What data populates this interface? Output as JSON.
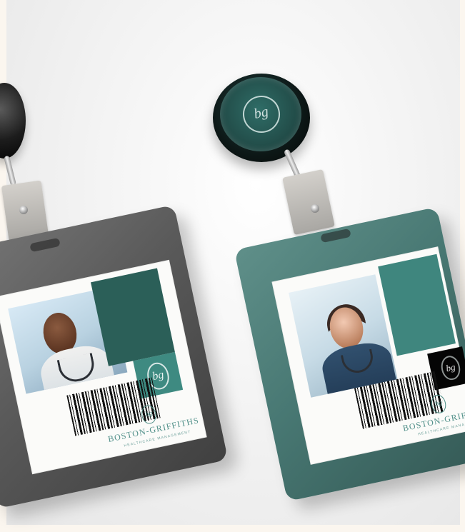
{
  "scene": {
    "logo_mark": "bg",
    "brand_name": "BOSTON-GRIFFITHS",
    "tagline": "HEALTHCARE MANAGEMENT"
  },
  "left_badge": {
    "brand_name": "BOSTON-GRIFFITHS",
    "tagline": "HEALTHCARE MANAGEMENT"
  },
  "right_badge": {
    "brand_name": "BOSTON-GRIFF",
    "tagline": "HEALTHCARE MANAGEM"
  }
}
